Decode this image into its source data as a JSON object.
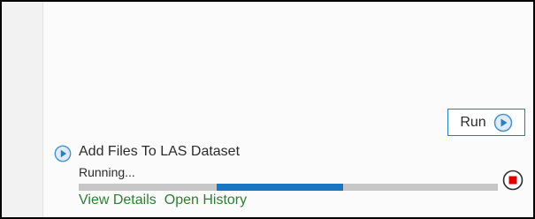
{
  "run_button": {
    "label": "Run",
    "icon": "play-circle-icon"
  },
  "task": {
    "title": "Add Files To LAS Dataset",
    "status": "Running...",
    "icon": "play-circle-icon",
    "progress": {
      "start_fraction": 0.33,
      "end_fraction": 0.63,
      "mode": "indeterminate"
    },
    "stop_icon": "stop-icon",
    "links": [
      {
        "label": "View Details"
      },
      {
        "label": "Open History"
      }
    ]
  },
  "colors": {
    "accent": "#1976c2",
    "link": "#2f7d32",
    "stop": "#e00000",
    "track": "#c7c7c7"
  }
}
